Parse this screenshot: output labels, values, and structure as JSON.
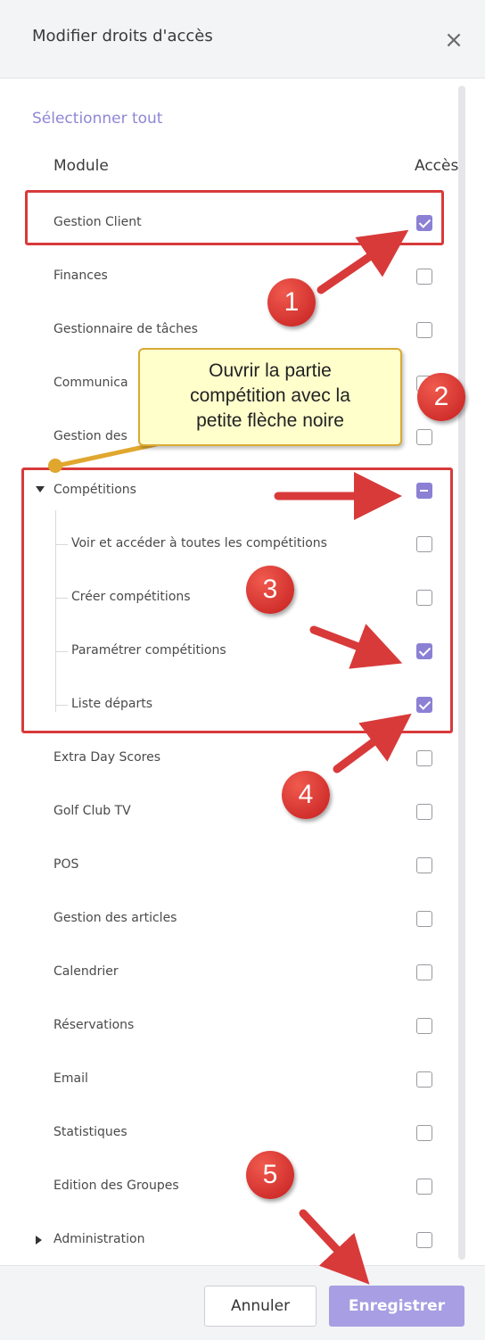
{
  "dialog": {
    "title": "Modifier droits d'accès",
    "close_icon": "×",
    "select_all": "Sélectionner tout",
    "col_module": "Module",
    "col_access": "Accès"
  },
  "modules": [
    {
      "label": "Gestion Client",
      "state": "checked"
    },
    {
      "label": "Finances",
      "state": "unchecked"
    },
    {
      "label": "Gestionnaire de tâches",
      "state": "unchecked"
    },
    {
      "label": "Communica",
      "state": "unchecked"
    },
    {
      "label": "Gestion des",
      "state": "unchecked"
    },
    {
      "label": "Compétitions",
      "state": "partial",
      "expanded": true,
      "children": [
        {
          "label": "Voir et accéder à toutes les compétitions",
          "state": "unchecked"
        },
        {
          "label": "Créer compétitions",
          "state": "unchecked"
        },
        {
          "label": "Paramétrer compétitions",
          "state": "checked"
        },
        {
          "label": "Liste départs",
          "state": "checked"
        }
      ]
    },
    {
      "label": "Extra Day Scores",
      "state": "unchecked"
    },
    {
      "label": "Golf Club TV",
      "state": "unchecked"
    },
    {
      "label": "POS",
      "state": "unchecked"
    },
    {
      "label": "Gestion des articles",
      "state": "unchecked"
    },
    {
      "label": "Calendrier",
      "state": "unchecked"
    },
    {
      "label": "Réservations",
      "state": "unchecked"
    },
    {
      "label": "Email",
      "state": "unchecked"
    },
    {
      "label": "Statistiques",
      "state": "unchecked"
    },
    {
      "label": "Edition des Groupes",
      "state": "unchecked"
    },
    {
      "label": "Administration",
      "state": "unchecked",
      "expanded": false
    }
  ],
  "buttons": {
    "cancel": "Annuler",
    "save": "Enregistrer"
  },
  "annotations": {
    "callout_lines": [
      "Ouvrir la partie",
      "compétition avec la",
      "petite flèche noire"
    ],
    "badges": [
      "1",
      "2",
      "3",
      "4",
      "5"
    ],
    "colors": {
      "annotation_red": "#d83a3a",
      "callout_fill": "#ffffcc",
      "callout_border": "#d9aa34",
      "accent": "#8b80d4"
    }
  }
}
